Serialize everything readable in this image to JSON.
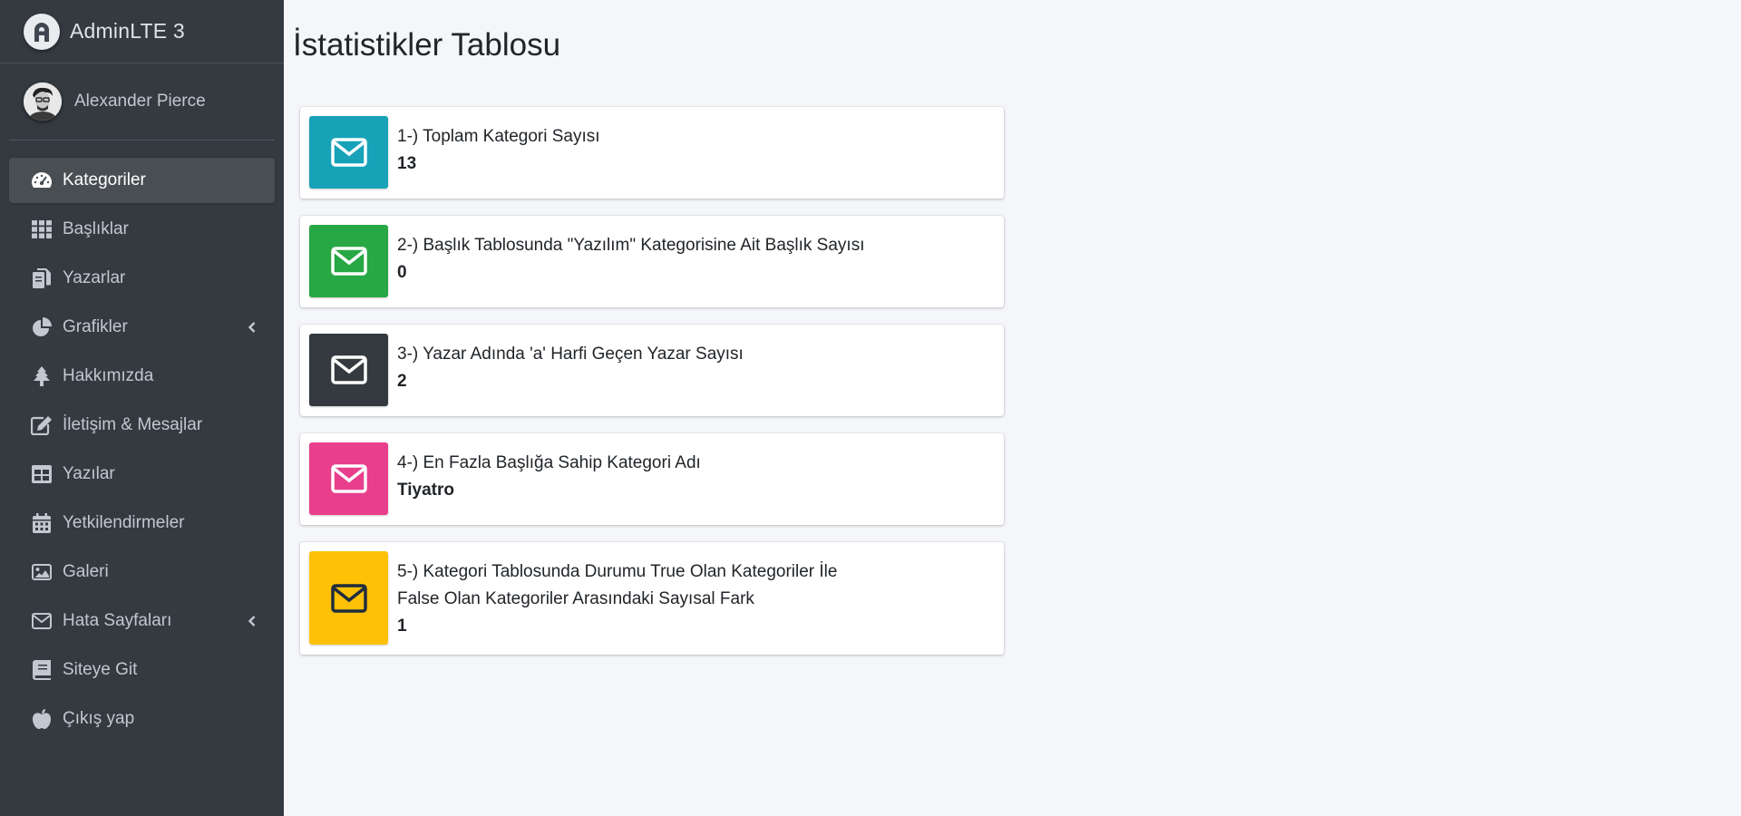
{
  "brand": {
    "name": "AdminLTE 3",
    "logo_letter": "A"
  },
  "user": {
    "name": "Alexander Pierce"
  },
  "sidebar": {
    "items": [
      {
        "label": "Kategoriler",
        "icon": "tachometer-icon",
        "active": true
      },
      {
        "label": "Başlıklar",
        "icon": "th-grid-icon"
      },
      {
        "label": "Yazarlar",
        "icon": "copy-icon"
      },
      {
        "label": "Grafikler",
        "icon": "chart-pie-icon",
        "has_submenu": true
      },
      {
        "label": "Hakkımızda",
        "icon": "tree-icon"
      },
      {
        "label": "İletişim & Mesajlar",
        "icon": "edit-icon"
      },
      {
        "label": "Yazılar",
        "icon": "table-icon"
      },
      {
        "label": "Yetkilendirmeler",
        "icon": "calendar-icon"
      },
      {
        "label": "Galeri",
        "icon": "image-icon"
      },
      {
        "label": "Hata Sayfaları",
        "icon": "envelope-icon",
        "has_submenu": true
      },
      {
        "label": "Siteye Git",
        "icon": "book-icon"
      },
      {
        "label": "Çıkış yap",
        "icon": "apple-icon"
      }
    ]
  },
  "main": {
    "title": "İstatistikler Tablosu",
    "cards": [
      {
        "label": "1-) Toplam Kategori Sayısı",
        "value": "13",
        "color": "#17a2b8",
        "icon": "envelope-icon"
      },
      {
        "label": "2-) Başlık Tablosunda \"Yazılım\" Kategorisine Ait Başlık Sayısı",
        "value": "0",
        "color": "#28a745",
        "icon": "envelope-icon"
      },
      {
        "label": "3-) Yazar Adında 'a' Harfi Geçen Yazar Sayısı",
        "value": "2",
        "color": "#343a40",
        "icon": "envelope-icon"
      },
      {
        "label": "4-) En Fazla Başlığa Sahip Kategori Adı",
        "value": "Tiyatro",
        "color": "#e83e8c",
        "icon": "envelope-icon"
      },
      {
        "label_line1": "5-) Kategori Tablosunda Durumu True Olan Kategoriler İle",
        "label_line2": "False Olan Kategoriler Arasındaki Sayısal Fark",
        "value": "1",
        "color": "#ffc107",
        "icon": "envelope-icon"
      }
    ]
  }
}
